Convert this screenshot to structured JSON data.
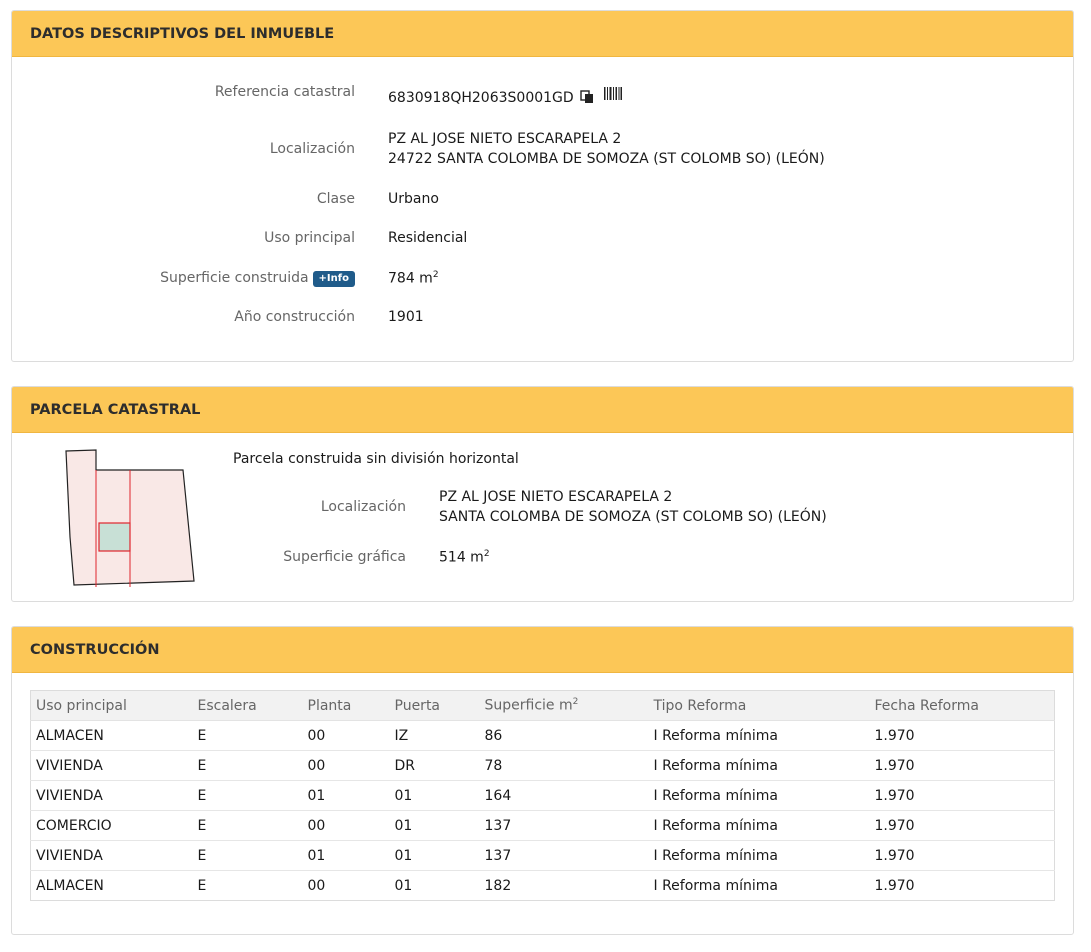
{
  "descriptivos": {
    "title": "DATOS DESCRIPTIVOS DEL INMUEBLE",
    "referencia_label": "Referencia catastral",
    "referencia_value": "6830918QH2063S0001GD",
    "localizacion_label": "Localización",
    "localizacion_line1": "PZ AL JOSE NIETO ESCARAPELA 2",
    "localizacion_line2": "24722 SANTA COLOMBA DE SOMOZA (ST COLOMB SO) (LEÓN)",
    "clase_label": "Clase",
    "clase_value": "Urbano",
    "uso_label": "Uso principal",
    "uso_value": "Residencial",
    "superficie_label": "Superficie construida",
    "info_badge": "+Info",
    "superficie_value": "784 m",
    "superficie_unit_exp": "2",
    "anio_label": "Año construcción",
    "anio_value": "1901"
  },
  "parcela": {
    "title": "PARCELA CATASTRAL",
    "descripcion": "Parcela construida sin división horizontal",
    "localizacion_label": "Localización",
    "localizacion_line1": "PZ AL JOSE NIETO ESCARAPELA 2",
    "localizacion_line2": "SANTA COLOMBA DE SOMOZA (ST COLOMB SO) (LEÓN)",
    "superficie_label": "Superficie gráfica",
    "superficie_value": "514 m",
    "superficie_unit_exp": "2"
  },
  "construccion": {
    "title": "CONSTRUCCIÓN",
    "headers": [
      "Uso principal",
      "Escalera",
      "Planta",
      "Puerta",
      "Superficie m",
      "Tipo Reforma",
      "Fecha Reforma"
    ],
    "superficie_header_exp": "2",
    "rows": [
      [
        "ALMACEN",
        "E",
        "00",
        "IZ",
        "86",
        "I Reforma mínima",
        "1.970"
      ],
      [
        "VIVIENDA",
        "E",
        "00",
        "DR",
        "78",
        "I Reforma mínima",
        "1.970"
      ],
      [
        "VIVIENDA",
        "E",
        "01",
        "01",
        "164",
        "I Reforma mínima",
        "1.970"
      ],
      [
        "COMERCIO",
        "E",
        "00",
        "01",
        "137",
        "I Reforma mínima",
        "1.970"
      ],
      [
        "VIVIENDA",
        "E",
        "01",
        "01",
        "137",
        "I Reforma mínima",
        "1.970"
      ],
      [
        "ALMACEN",
        "E",
        "00",
        "01",
        "182",
        "I Reforma mínima",
        "1.970"
      ]
    ]
  },
  "icons": {
    "copy": "copy-icon",
    "barcode": "barcode-icon",
    "parcel_map": "parcel-map-icon"
  },
  "colors": {
    "header_bg": "#fcc757",
    "badge_bg": "#1f5b8a",
    "parcel_fill": "#f9e8e6",
    "parcel_highlight": "#c8e0d6",
    "parcel_border_red": "#e0242c"
  }
}
